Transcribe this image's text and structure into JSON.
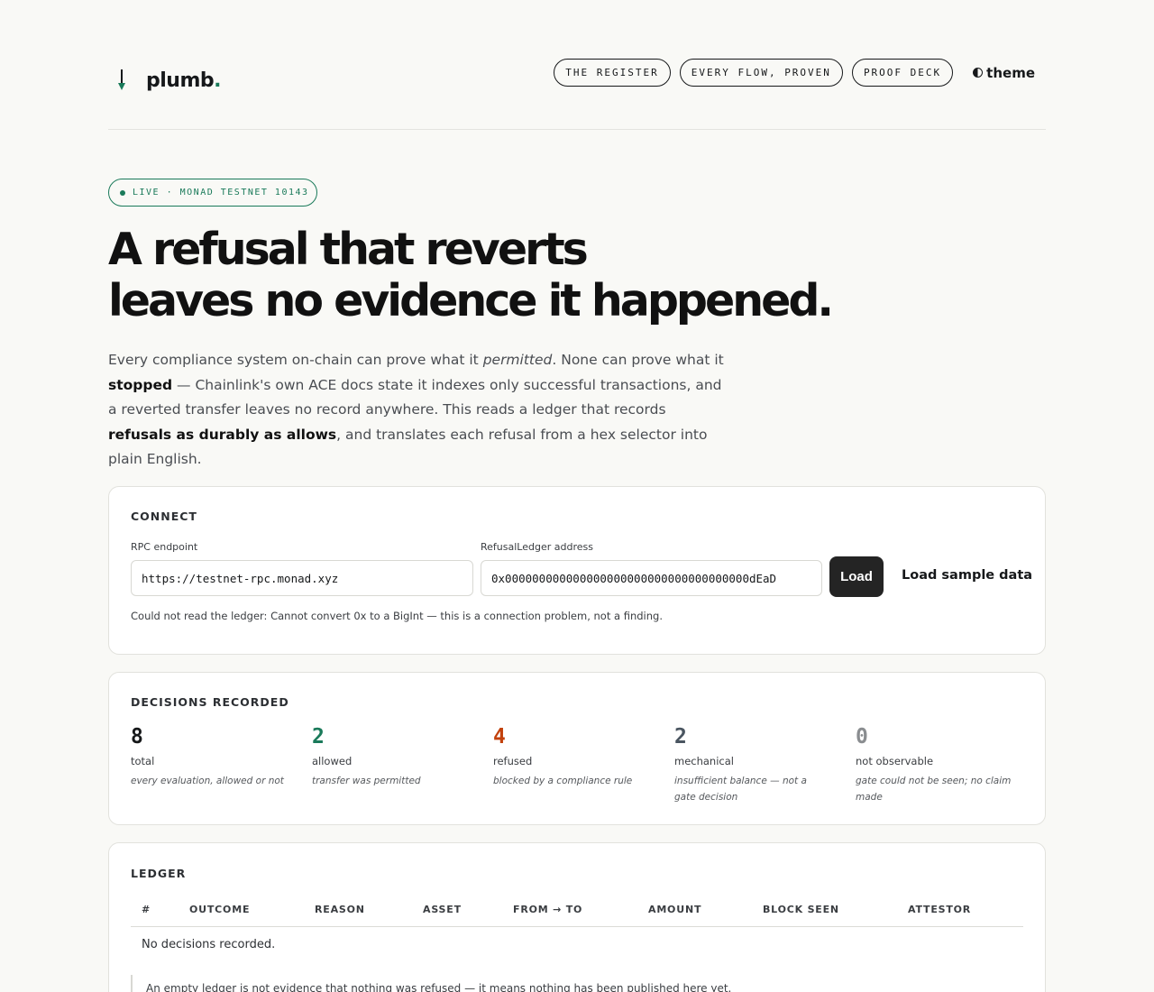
{
  "header": {
    "logo_text": "plumb",
    "logo_dot": ".",
    "nav": [
      "THE REGISTER",
      "EVERY FLOW, PROVEN",
      "PROOF DECK"
    ],
    "theme_label": "theme"
  },
  "badge": "LIVE · MONAD TESTNET 10143",
  "hero": {
    "title_line1": "A refusal that reverts",
    "title_line2": "leaves no evidence it happened.",
    "body": {
      "p1": "Every compliance system on-chain can prove what it ",
      "permitted": "permitted",
      "p2": ". None can prove what it ",
      "stopped": "stopped",
      "p3": " — Chainlink's own ACE docs state it indexes only successful transactions, and a reverted transfer leaves no record anywhere. This reads a ledger that records ",
      "refusals": "refusals as durably as allows",
      "p4": ", and translates each refusal from a hex selector into plain English."
    }
  },
  "connect": {
    "title": "CONNECT",
    "rpc_label": "RPC endpoint",
    "rpc_value": "https://testnet-rpc.monad.xyz",
    "address_label": "RefusalLedger address",
    "address_value": "0x000000000000000000000000000000000000dEaD",
    "load_label": "Load",
    "sample_label": "Load sample data",
    "error": "Could not read the ledger: Cannot convert 0x to a BigInt — this is a connection problem, not a finding."
  },
  "decisions": {
    "title": "DECISIONS RECORDED",
    "stats": [
      {
        "value": "8",
        "label": "total",
        "desc": "every evaluation, allowed or not",
        "color": "#16181a"
      },
      {
        "value": "2",
        "label": "allowed",
        "desc": "transfer was permitted",
        "color": "#1a7a5a"
      },
      {
        "value": "4",
        "label": "refused",
        "desc": "blocked by a compliance rule",
        "color": "#c2410c"
      },
      {
        "value": "2",
        "label": "mechanical",
        "desc": "insufficient balance — not a gate decision",
        "color": "#4a5560"
      },
      {
        "value": "0",
        "label": "not observable",
        "desc": "gate could not be seen; no claim made",
        "color": "#8a8d90"
      }
    ]
  },
  "ledger": {
    "title": "LEDGER",
    "columns": [
      "#",
      "OUTCOME",
      "REASON",
      "ASSET",
      "FROM → TO",
      "AMOUNT",
      "BLOCK SEEN",
      "ATTESTOR"
    ],
    "empty": "No decisions recorded.",
    "note": "An empty ledger is not evidence that nothing was refused — it means nothing has been published here yet."
  }
}
